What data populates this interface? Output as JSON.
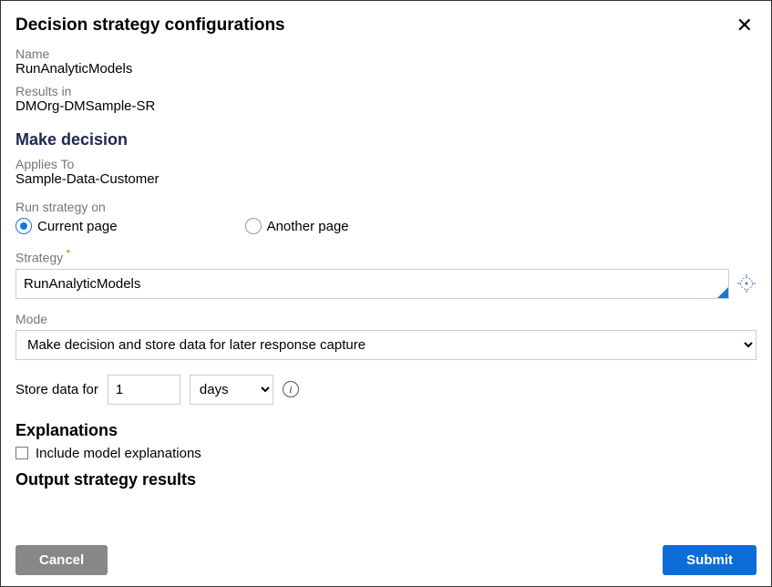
{
  "header": {
    "title": "Decision strategy configurations"
  },
  "top": {
    "name_label": "Name",
    "name_value": "RunAnalyticModels",
    "results_label": "Results in",
    "results_value": "DMOrg-DMSample-SR"
  },
  "decision": {
    "section_title": "Make decision",
    "applies_label": "Applies To",
    "applies_value": "Sample-Data-Customer",
    "run_label": "Run strategy on",
    "radio_current": "Current page",
    "radio_another": "Another page",
    "strategy_label": "Strategy",
    "strategy_value": "RunAnalyticModels",
    "mode_label": "Mode",
    "mode_value": "Make decision and store data for later response capture",
    "store_label": "Store data for",
    "store_value": "1",
    "store_unit": "days"
  },
  "explanations": {
    "section_title": "Explanations",
    "checkbox_label": "Include model explanations"
  },
  "output": {
    "section_title": "Output strategy results"
  },
  "footer": {
    "cancel": "Cancel",
    "submit": "Submit"
  }
}
